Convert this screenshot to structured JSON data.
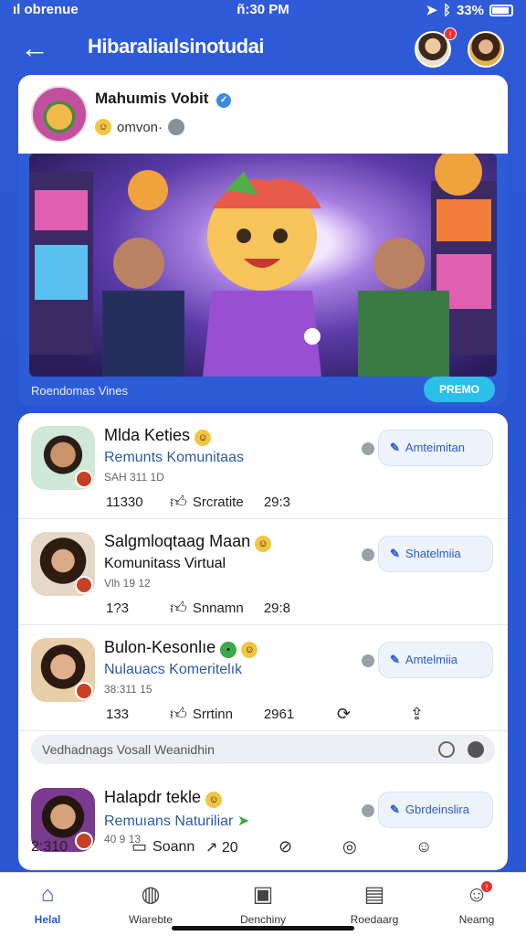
{
  "status_bar": {
    "carrier": "ıl obrenue",
    "time": "ñ:30 PM",
    "battery": "33%"
  },
  "header": {
    "title": "Hibaraliaılsinotudai"
  },
  "featured": {
    "author": "Mahuımis Vobit",
    "subtitle": "omvon·",
    "caption": "Roendomas Vines",
    "button": "PREMO"
  },
  "posts": [
    {
      "title": "Mlda Keties",
      "sub": "Remunts Komunitaas",
      "meta": "SAH 311 1D",
      "count": "11330",
      "like_label": "Srcratite",
      "time": "29:3",
      "action": "Amteimitan"
    },
    {
      "title": "Salgmloqtaag Maan",
      "sub": "Komunitass Virtual",
      "meta": "Vlh 19 12",
      "count": "1?3",
      "like_label": "Snnamn",
      "time": "29:8",
      "action": "Shatelmiia"
    },
    {
      "title": "Bulon-Kesonlıe",
      "sub": "Nulauacs Komeritelık",
      "meta": "38:311 15",
      "count": "133",
      "like_label": "Srrtinn",
      "time": "2961",
      "action": "Amtelmiia"
    },
    {
      "title": "Halapdr tekle",
      "sub": "Remuıans Naturiliar",
      "meta": "40 9 13",
      "count": "2:310",
      "like_label": "Soann",
      "time": "20",
      "action": "Gbrdeinslira"
    }
  ],
  "search": {
    "placeholder": "Vedhadnags Vosall Weanidhin"
  },
  "nav": [
    {
      "label": "Helal",
      "icon": "home-icon"
    },
    {
      "label": "Wiarebte",
      "icon": "explore-icon"
    },
    {
      "label": "Denchiny",
      "icon": "gallery-icon"
    },
    {
      "label": "Roedaarg",
      "icon": "chat-icon"
    },
    {
      "label": "Neamg",
      "icon": "profile-icon"
    }
  ],
  "colors": {
    "background": "#2b57d3",
    "accent": "#2a5bd0",
    "premium_button": "#2cbfe9",
    "notification": "#e8312f"
  }
}
